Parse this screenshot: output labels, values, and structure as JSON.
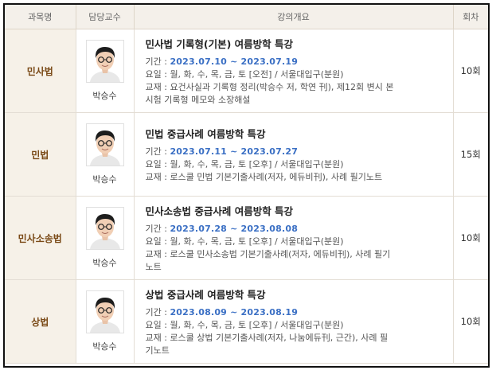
{
  "header": {
    "subject": "과목명",
    "professor": "담당교수",
    "overview": "강의개요",
    "sessions": "회차"
  },
  "courses": [
    {
      "subject": "민사법",
      "professor": "박승수",
      "title": "민사법 기록형(기본) 여름방학 특강",
      "period_label": "기간 :",
      "period": "2023.07.10 ~ 2023.07.19",
      "days": "요일 : 월, 화, 수, 목, 금, 토 [오전] / 서울대입구(분원)",
      "textbook_1": "교재 : 요건사실과 기록형 정리(박승수 저, 학연 刊), 제12회 변시 본",
      "textbook_2": "시험 기록형 메모와 소장해설",
      "sessions": "10회"
    },
    {
      "subject": "민법",
      "professor": "박승수",
      "title": "민법 중급사례 여름방학 특강",
      "period_label": "기간 :",
      "period": "2023.07.11 ~ 2023.07.27",
      "days": "요일 : 월, 화, 수, 목, 금, 토 [오후] / 서울대입구(분원)",
      "textbook_1": "교재 : 로스쿨 민법 기본기출사례(저자, 에듀비刊), 사례 필기노트",
      "textbook_2": "",
      "sessions": "15회"
    },
    {
      "subject": "민사소송법",
      "professor": "박승수",
      "title": "민사소송법 중급사례 여름방학 특강",
      "period_label": "기간 :",
      "period": "2023.07.28 ~ 2023.08.08",
      "days": "요일 : 월, 화, 수, 목, 금, 토 [오후] / 서울대입구(분원)",
      "textbook_1": "교재 : 로스쿨 민사소송법 기본기출사례(저자, 에듀비刊), 사례 필기",
      "textbook_2": "노트",
      "sessions": "10회"
    },
    {
      "subject": "상법",
      "professor": "박승수",
      "title": "상법 중급사례 여름방학 특강",
      "period_label": "기간 :",
      "period": "2023.08.09 ~ 2023.08.19",
      "days": "요일 : 월, 화, 수, 목, 금, 토 [오후] / 서울대입구(분원)",
      "textbook_1": "교재 : 로스쿨 상법 기본기출사례(저자, 나눔에듀刊, 근간), 사례 필",
      "textbook_2": "기노트",
      "sessions": "10회"
    }
  ]
}
